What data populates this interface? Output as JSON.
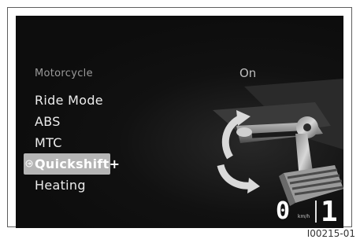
{
  "menu": {
    "header": "Motorcycle",
    "items": [
      {
        "label": "Ride Mode",
        "selected": false
      },
      {
        "label": "ABS",
        "selected": false
      },
      {
        "label": "MTC",
        "selected": false
      },
      {
        "label": "Quickshift+",
        "selected": true
      },
      {
        "label": "Heating",
        "selected": false
      }
    ]
  },
  "status": {
    "value": "On"
  },
  "dashboard": {
    "speed": "0",
    "speed_unit": "km/h",
    "gear": "1"
  },
  "figure_id": "I00215-01",
  "colors": {
    "screen_background": "#0d0d0d",
    "selection_highlight": "#b5b5b5",
    "text_primary": "#ececec",
    "text_muted": "#9a9a9a"
  },
  "icons": {
    "selection_marker": "arrow-right-icon",
    "illustration": "gear-shift-pedal-illustration"
  }
}
